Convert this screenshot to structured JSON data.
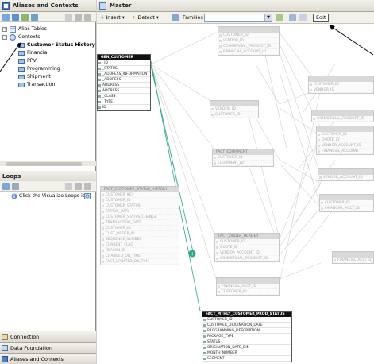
{
  "left_panel": {
    "title": "Aliases and Contexts",
    "tree": [
      {
        "label": "Alias Tables",
        "level": 0,
        "expander": "+",
        "icon": "alias-tables-icon"
      },
      {
        "label": "Contexts",
        "level": 0,
        "expander": "-",
        "icon": "contexts-icon"
      },
      {
        "label": "Customer Status History [",
        "level": 1,
        "icon": "context-icon",
        "selected": true
      },
      {
        "label": "Financial",
        "level": 1,
        "icon": "context-icon"
      },
      {
        "label": "PPV",
        "level": 1,
        "icon": "context-icon"
      },
      {
        "label": "Programming",
        "level": 1,
        "icon": "context-icon"
      },
      {
        "label": "Shipment",
        "level": 1,
        "icon": "context-icon"
      },
      {
        "label": "Transaction",
        "level": 1,
        "icon": "context-icon"
      }
    ]
  },
  "loops_panel": {
    "title": "Loops",
    "message": "Click the Visualize Loops icon"
  },
  "bottom_tabs": [
    "Connection",
    "Data Foundation",
    "Aliases and Contexts"
  ],
  "main": {
    "title": "Master",
    "toolbar": {
      "insert": "Insert",
      "detect": "Detect",
      "families_label": "Families",
      "families_value": "",
      "edit": "Edit"
    }
  },
  "active_tables": [
    {
      "name": "GEN_CUSTOMER",
      "columns": [
        "_ID",
        "_STATUS",
        "_ADDRESS_INFORMATION",
        "_ADDRESS",
        "ADDRESS",
        "ADDRESS",
        "_CLASS",
        "_TYPE",
        "ID"
      ]
    },
    {
      "name": "FACT_MTHLY_CUSTOMER_PROD_STATUS",
      "columns": [
        "CUSTOMER_ID",
        "CUSTOMER_ORIGINATION_DATE",
        "PROGRAMMING_DESCRIPTION",
        "PACKAGE_TYPE",
        "STATUS",
        "ORIGINATION_DATE_DIM",
        "MONTH_NUMBER",
        "SEGMENT"
      ]
    }
  ],
  "faded_tables": [
    {
      "name": "",
      "columns": [
        "CUSTOMER_ID",
        "VENDOR_ID",
        "COMMERCIAL_PRODUCT_ID",
        "FINANCIAL_ACCOUNT_ID"
      ]
    },
    {
      "name": "",
      "columns": [
        "VENDOR_ID",
        "CUSTOMER_ID"
      ]
    },
    {
      "name": "FACT_EQUIPMENT",
      "columns": [
        "CUSTOMER_ID",
        "EQUIPMENT_ID"
      ]
    },
    {
      "name": "FACT_CUSTOMER_STATUS_HISTORY",
      "columns": [
        "CUSTOMER_KEY",
        "CUSTOMER_ID",
        "CUSTOMER_STATUS",
        "STATUS_DATE",
        "CUSTOMER_STATUS_CHANGE",
        "TRANSACTION_DATE",
        "CUSTOMER_ID",
        "CUST_ORDER_ID",
        "SEQUENCE_NUMBER",
        "CURRENT_FLAG",
        "REASON_ID",
        "CHANGED_ON_TIME",
        "FACT_UPDATED_ON_TIME",
        "HISTORY_ID"
      ]
    },
    {
      "name": "FACT_ORDER_HEADER",
      "columns": [
        "CUSTOMER_ID",
        "QUOTE_ID",
        "VENDOR_ACCOUNT_ID",
        "COMMERCIAL_PRODUCT_ID"
      ]
    },
    {
      "name": "",
      "columns": [
        "FINANCIAL_ACCT_ID",
        "CUSTOMER_ID"
      ]
    },
    {
      "name": "",
      "columns": [
        "CUSTOMER_ID",
        "VENDOR_ID"
      ]
    },
    {
      "name": "",
      "columns": [
        "COMMERCIAL_PRODUCT_ID"
      ]
    },
    {
      "name": "",
      "columns": [
        "CUSTOMER_ID",
        "QUOTE_ID",
        "VENDOR_ACCOUNT_ID",
        "FINANCIAL_ACCOUNT"
      ]
    },
    {
      "name": "",
      "columns": [
        "VENDOR_ACCOUNT_ID"
      ]
    },
    {
      "name": "",
      "columns": [
        "CUSTOMER_ID",
        "FINANCIAL_ACCT_ID"
      ]
    },
    {
      "name": "",
      "columns": [
        "FINANCIAL_ACCT_ID"
      ]
    }
  ],
  "colors": {
    "join_highlight": "#2aa58a",
    "join_faded": "#c8c8c8",
    "active_header": "#111111",
    "panel_header": "#dedad2"
  }
}
